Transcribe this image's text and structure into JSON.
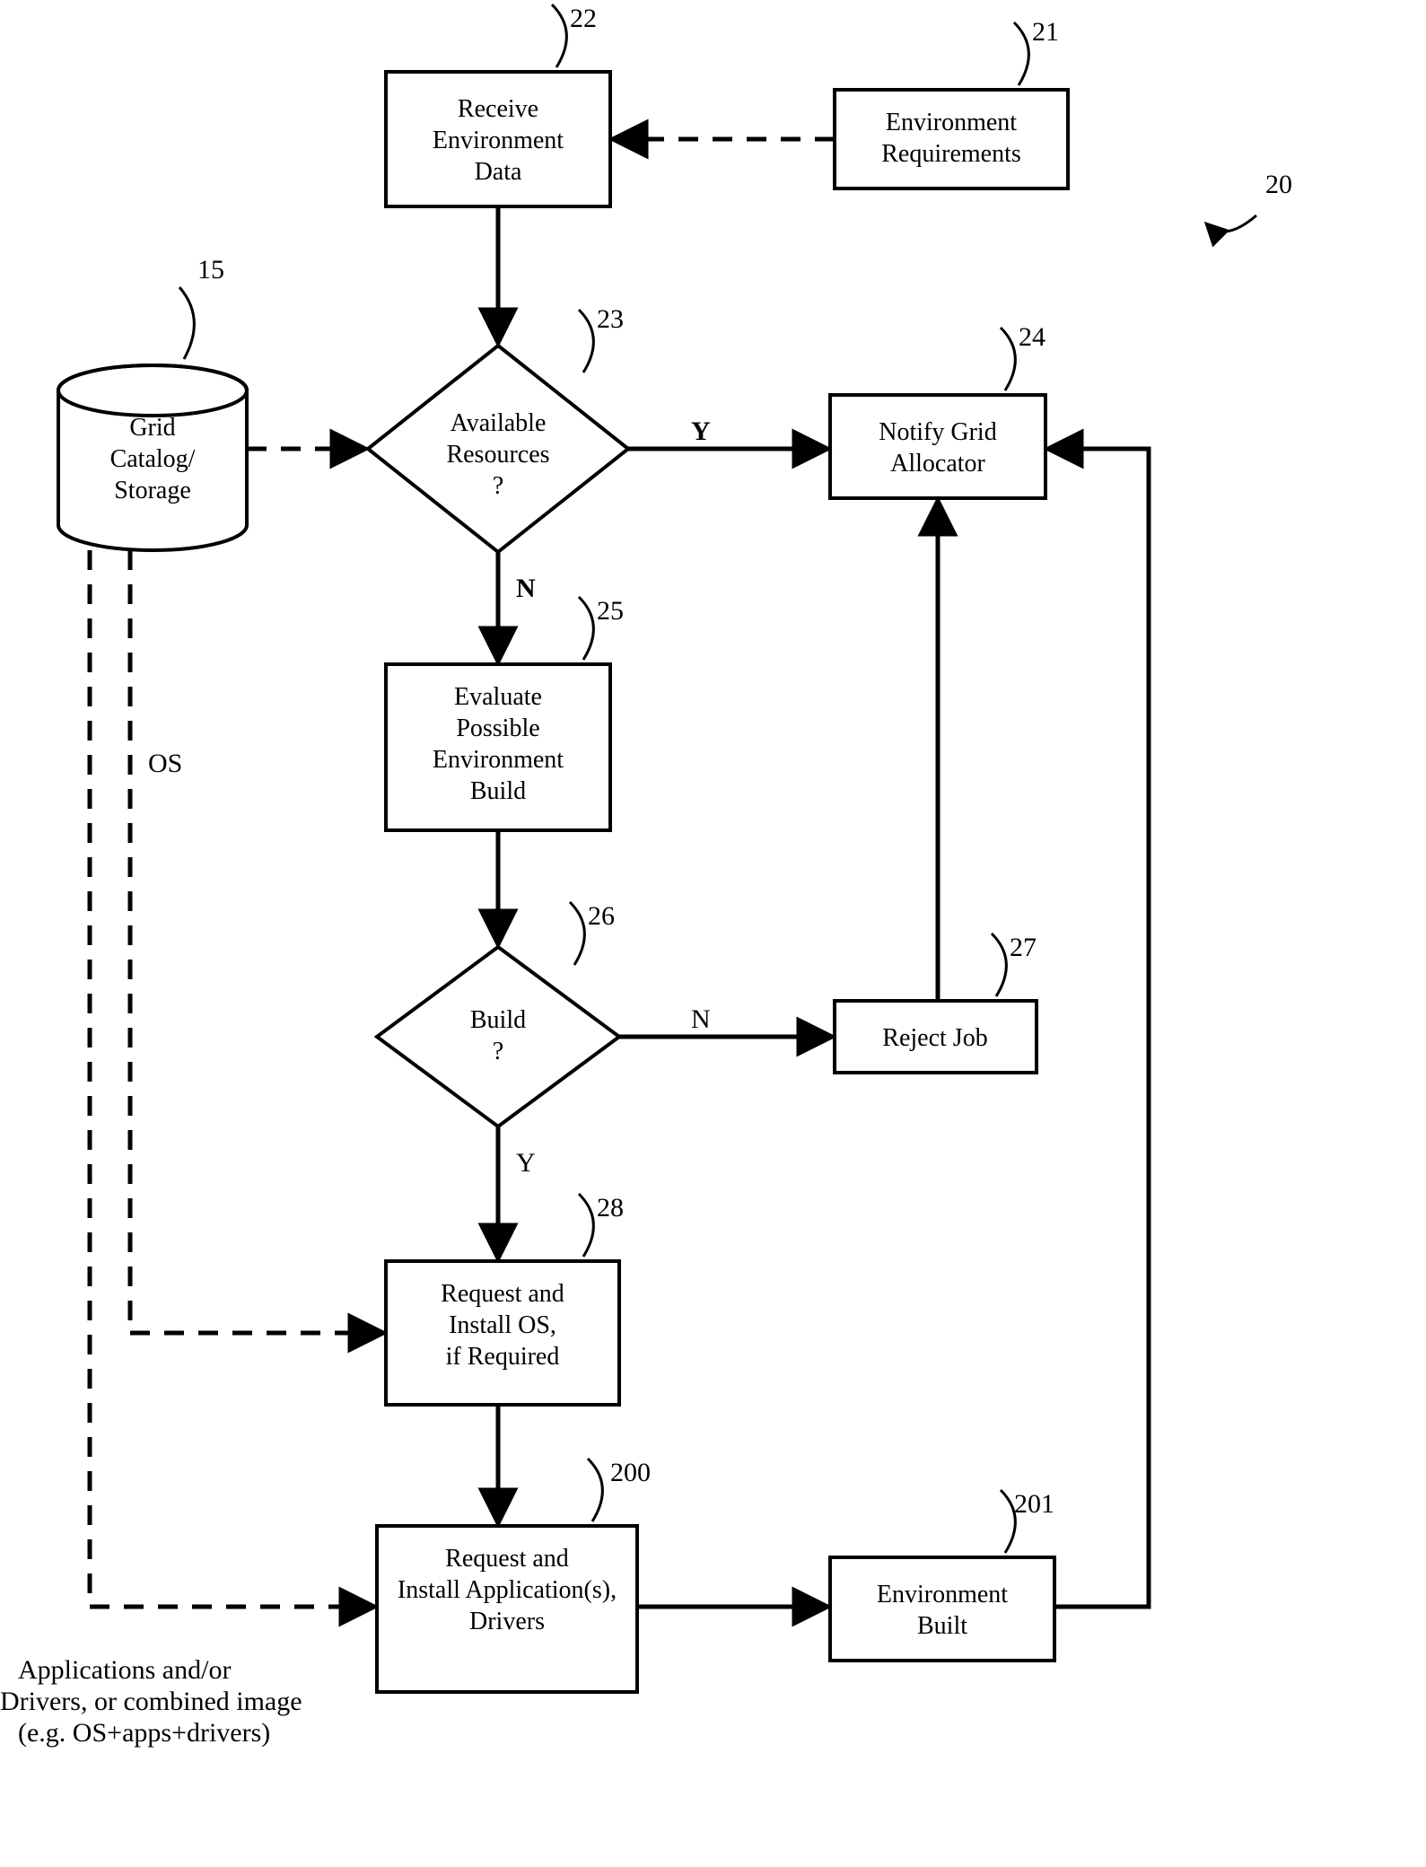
{
  "figure_ref": "20",
  "nodes": {
    "n15": {
      "ref": "15",
      "text": "Grid Catalog/ Storage"
    },
    "n21": {
      "ref": "21",
      "text": "Environment Requirements"
    },
    "n22": {
      "ref": "22",
      "text": "Receive Environment Data"
    },
    "n23": {
      "ref": "23",
      "text": "Available Resources ?"
    },
    "n24": {
      "ref": "24",
      "text": "Notify Grid Allocator"
    },
    "n25": {
      "ref": "25",
      "text": "Evaluate Possible Environment Build"
    },
    "n26": {
      "ref": "26",
      "text": "Build ?"
    },
    "n27": {
      "ref": "27",
      "text": "Reject Job"
    },
    "n28": {
      "ref": "28",
      "text": "Request and Install OS, if Required"
    },
    "n200": {
      "ref": "200",
      "text": "Request and Install Application(s), Drivers"
    },
    "n201": {
      "ref": "201",
      "text": "Environment Built"
    }
  },
  "edge_labels": {
    "e23y": "Y",
    "e23n": "N",
    "e26n": "N",
    "e26y": "Y",
    "os": "OS",
    "apps": "Applications and/or Drivers, or combined image (e.g. OS+apps+drivers)"
  }
}
